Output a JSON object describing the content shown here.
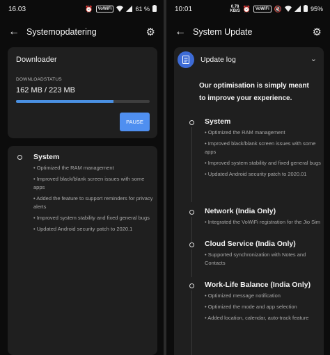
{
  "left": {
    "status": {
      "time": "16.03",
      "network_chip": "VoWiFi",
      "battery": "61 %"
    },
    "appbar": {
      "title": "Systemopdatering"
    },
    "download": {
      "title": "Downloader",
      "status_label": "DOWNLOADSTATUS",
      "size": "162 MB / 223 MB",
      "progress": 0.73,
      "pause_label": "PAUSE"
    },
    "log": {
      "section_title": "System",
      "items": [
        "Optimized the RAM management",
        "Improved black/blank screen issues with some apps",
        "Added the feature to support reminders for privacy alerts",
        "Improved system stability and fixed general bugs",
        "Updated Android security patch to 2020.1"
      ]
    }
  },
  "right": {
    "status": {
      "time": "10:01",
      "network_speed_value": "0.78",
      "network_speed_unit": "KB/S",
      "network_chip": "VoWiFi",
      "battery": "95%"
    },
    "appbar": {
      "title": "System Update"
    },
    "update_log": {
      "header": "Update log",
      "intro": "Our optimisation is simply meant to improve your experience.",
      "sections": [
        {
          "title": "System",
          "items": [
            "Optimized the RAM management",
            "Improved black/blank screen issues with some apps",
            "Improved system stability and fixed general bugs",
            "Updated Android security patch to 2020.01"
          ]
        },
        {
          "title": "Network (India Only)",
          "items": [
            "Integrated the VoWiFi registration for the Jio Sim"
          ]
        },
        {
          "title": "Cloud Service (India Only)",
          "items": [
            "Supported synchronization with Notes and Contacts"
          ]
        },
        {
          "title": "Work-Life Balance (India Only)",
          "items": [
            "Optimized message notification",
            "Optimized the mode and app selection",
            "Added location, calendar, auto-track feature"
          ]
        }
      ]
    }
  },
  "colors": {
    "accent": "#4f8ff0",
    "card": "#1f1f1f",
    "background": "#0c0c0c"
  },
  "icons": [
    "back-arrow-icon",
    "gear-icon",
    "wifi-icon",
    "signal-icon",
    "battery-icon",
    "document-icon",
    "chevron-down-icon",
    "alarm-icon"
  ]
}
